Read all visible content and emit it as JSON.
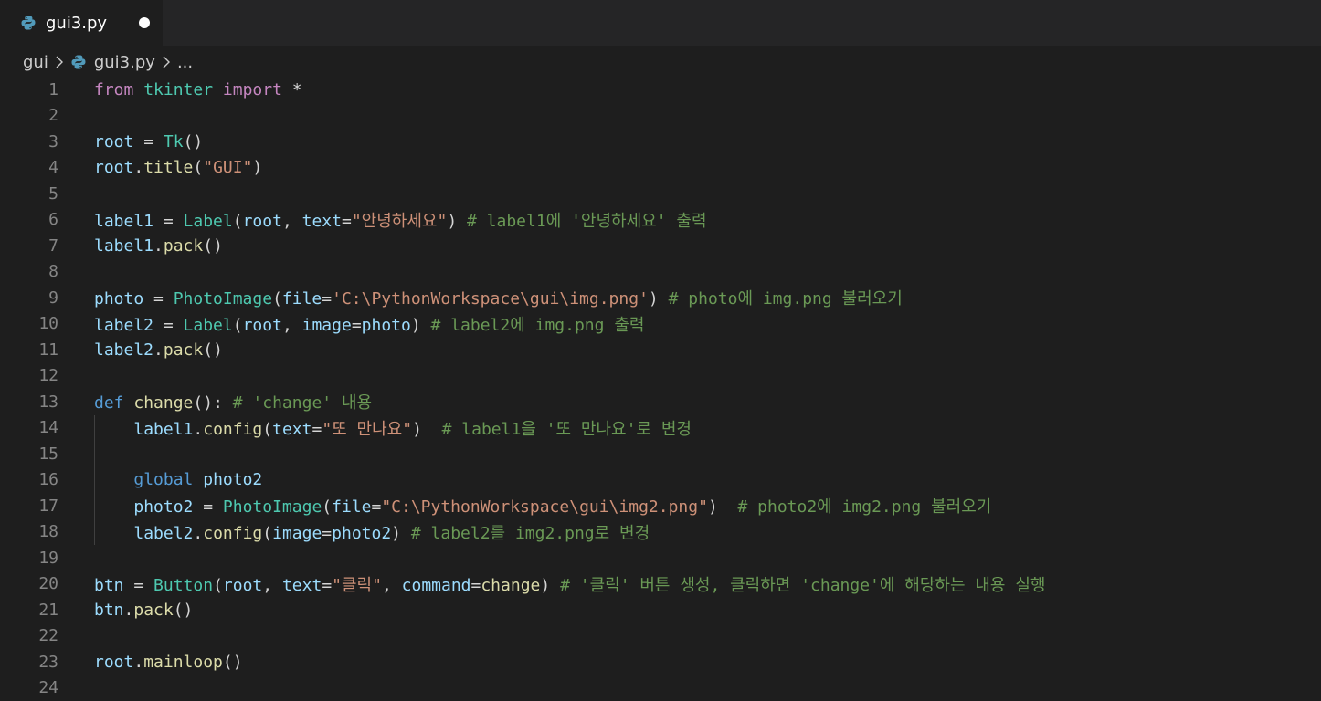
{
  "tab": {
    "title": "gui3.py",
    "dirty": true
  },
  "breadcrumb": {
    "folder": "gui",
    "file": "gui3.py",
    "symbol": "..."
  },
  "colors": {
    "background": "#1e1e1e",
    "keyword_control": "#c586c0",
    "keyword_def": "#569cd6",
    "function": "#dcdcaa",
    "class": "#4ec9b0",
    "variable": "#9cdcfe",
    "string": "#ce9178",
    "comment": "#6a9955"
  },
  "editor": {
    "lines": [
      {
        "n": "1",
        "tokens": [
          [
            "kw",
            "from"
          ],
          [
            "op",
            " "
          ],
          [
            "cls",
            "tkinter"
          ],
          [
            "op",
            " "
          ],
          [
            "kw",
            "import"
          ],
          [
            "op",
            " *"
          ]
        ]
      },
      {
        "n": "2",
        "tokens": []
      },
      {
        "n": "3",
        "tokens": [
          [
            "var",
            "root"
          ],
          [
            "op",
            " = "
          ],
          [
            "cls",
            "Tk"
          ],
          [
            "op",
            "()"
          ]
        ]
      },
      {
        "n": "4",
        "tokens": [
          [
            "var",
            "root"
          ],
          [
            "op",
            "."
          ],
          [
            "fn",
            "title"
          ],
          [
            "op",
            "("
          ],
          [
            "str",
            "\"GUI\""
          ],
          [
            "op",
            ")"
          ]
        ]
      },
      {
        "n": "5",
        "tokens": []
      },
      {
        "n": "6",
        "tokens": [
          [
            "var",
            "label1"
          ],
          [
            "op",
            " = "
          ],
          [
            "cls",
            "Label"
          ],
          [
            "op",
            "("
          ],
          [
            "var",
            "root"
          ],
          [
            "op",
            ", "
          ],
          [
            "var",
            "text"
          ],
          [
            "op",
            "="
          ],
          [
            "str",
            "\"안녕하세요\""
          ],
          [
            "op",
            ") "
          ],
          [
            "com",
            "# label1에 '안녕하세요' 출력"
          ]
        ]
      },
      {
        "n": "7",
        "tokens": [
          [
            "var",
            "label1"
          ],
          [
            "op",
            "."
          ],
          [
            "fn",
            "pack"
          ],
          [
            "op",
            "()"
          ]
        ]
      },
      {
        "n": "8",
        "tokens": []
      },
      {
        "n": "9",
        "tokens": [
          [
            "var",
            "photo"
          ],
          [
            "op",
            " = "
          ],
          [
            "cls",
            "PhotoImage"
          ],
          [
            "op",
            "("
          ],
          [
            "var",
            "file"
          ],
          [
            "op",
            "="
          ],
          [
            "str",
            "'C:\\PythonWorkspace\\gui\\img.png'"
          ],
          [
            "op",
            ") "
          ],
          [
            "com",
            "# photo에 img.png 불러오기"
          ]
        ]
      },
      {
        "n": "10",
        "tokens": [
          [
            "var",
            "label2"
          ],
          [
            "op",
            " = "
          ],
          [
            "cls",
            "Label"
          ],
          [
            "op",
            "("
          ],
          [
            "var",
            "root"
          ],
          [
            "op",
            ", "
          ],
          [
            "var",
            "image"
          ],
          [
            "op",
            "="
          ],
          [
            "var",
            "photo"
          ],
          [
            "op",
            ") "
          ],
          [
            "com",
            "# label2에 img.png 출력"
          ]
        ]
      },
      {
        "n": "11",
        "tokens": [
          [
            "var",
            "label2"
          ],
          [
            "op",
            "."
          ],
          [
            "fn",
            "pack"
          ],
          [
            "op",
            "()"
          ]
        ]
      },
      {
        "n": "12",
        "tokens": []
      },
      {
        "n": "13",
        "tokens": [
          [
            "def",
            "def"
          ],
          [
            "op",
            " "
          ],
          [
            "fn",
            "change"
          ],
          [
            "op",
            "(): "
          ],
          [
            "com",
            "# 'change' 내용"
          ]
        ]
      },
      {
        "n": "14",
        "tokens": [
          [
            "op",
            "    "
          ],
          [
            "var",
            "label1"
          ],
          [
            "op",
            "."
          ],
          [
            "fn",
            "config"
          ],
          [
            "op",
            "("
          ],
          [
            "var",
            "text"
          ],
          [
            "op",
            "="
          ],
          [
            "str",
            "\"또 만나요\""
          ],
          [
            "op",
            ")  "
          ],
          [
            "com",
            "# label1을 '또 만나요'로 변경"
          ]
        ]
      },
      {
        "n": "15",
        "tokens": []
      },
      {
        "n": "16",
        "tokens": [
          [
            "op",
            "    "
          ],
          [
            "def",
            "global"
          ],
          [
            "op",
            " "
          ],
          [
            "var",
            "photo2"
          ]
        ]
      },
      {
        "n": "17",
        "tokens": [
          [
            "op",
            "    "
          ],
          [
            "var",
            "photo2"
          ],
          [
            "op",
            " = "
          ],
          [
            "cls",
            "PhotoImage"
          ],
          [
            "op",
            "("
          ],
          [
            "var",
            "file"
          ],
          [
            "op",
            "="
          ],
          [
            "str",
            "\"C:\\PythonWorkspace\\gui\\img2.png\""
          ],
          [
            "op",
            ")  "
          ],
          [
            "com",
            "# photo2에 img2.png 불러오기"
          ]
        ]
      },
      {
        "n": "18",
        "tokens": [
          [
            "op",
            "    "
          ],
          [
            "var",
            "label2"
          ],
          [
            "op",
            "."
          ],
          [
            "fn",
            "config"
          ],
          [
            "op",
            "("
          ],
          [
            "var",
            "image"
          ],
          [
            "op",
            "="
          ],
          [
            "var",
            "photo2"
          ],
          [
            "op",
            ") "
          ],
          [
            "com",
            "# label2를 img2.png로 변경"
          ]
        ]
      },
      {
        "n": "19",
        "tokens": []
      },
      {
        "n": "20",
        "tokens": [
          [
            "var",
            "btn"
          ],
          [
            "op",
            " = "
          ],
          [
            "cls",
            "Button"
          ],
          [
            "op",
            "("
          ],
          [
            "var",
            "root"
          ],
          [
            "op",
            ", "
          ],
          [
            "var",
            "text"
          ],
          [
            "op",
            "="
          ],
          [
            "str",
            "\"클릭\""
          ],
          [
            "op",
            ", "
          ],
          [
            "var",
            "command"
          ],
          [
            "op",
            "="
          ],
          [
            "fn",
            "change"
          ],
          [
            "op",
            ") "
          ],
          [
            "com",
            "# '클릭' 버튼 생성, 클릭하면 'change'에 해당하는 내용 실행"
          ]
        ]
      },
      {
        "n": "21",
        "tokens": [
          [
            "var",
            "btn"
          ],
          [
            "op",
            "."
          ],
          [
            "fn",
            "pack"
          ],
          [
            "op",
            "()"
          ]
        ]
      },
      {
        "n": "22",
        "tokens": []
      },
      {
        "n": "23",
        "tokens": [
          [
            "var",
            "root"
          ],
          [
            "op",
            "."
          ],
          [
            "fn",
            "mainloop"
          ],
          [
            "op",
            "()"
          ]
        ]
      },
      {
        "n": "24",
        "tokens": []
      }
    ]
  }
}
